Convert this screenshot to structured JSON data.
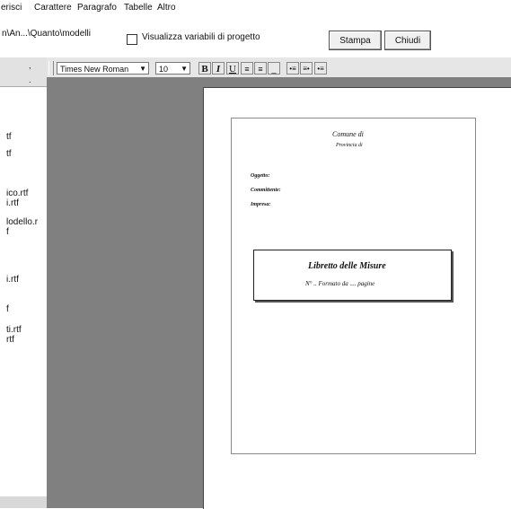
{
  "menu": {
    "items": [
      "erisci",
      "Carattere",
      "Paragrafo",
      "Tabelle",
      "Altro"
    ]
  },
  "options": {
    "path": "n\\An...\\Quanto\\modelli",
    "visualizza_label": "Visualizza variabili di progetto",
    "visualizza_checked": false,
    "stampa_label": "Stampa",
    "chiudi_label": "Chiudi"
  },
  "left_panel": {
    "files": [
      "tf",
      "tf",
      "ico.rtf",
      "i.rtf",
      "lodello.r",
      "f",
      "i.rtf",
      "f",
      "ti.rtf",
      "rtf"
    ]
  },
  "format_toolbar": {
    "font": "Times New Roman",
    "size": "10",
    "bold": "B",
    "italic": "I",
    "underline": "U"
  },
  "document": {
    "comune": "Comune di",
    "provincia": "Provincia di",
    "oggetto": "Oggetto:",
    "committente": "Committente:",
    "impresa": "Impresa:",
    "title": "Libretto delle Misure",
    "formato": "N° .. Formato da .... pagine"
  }
}
